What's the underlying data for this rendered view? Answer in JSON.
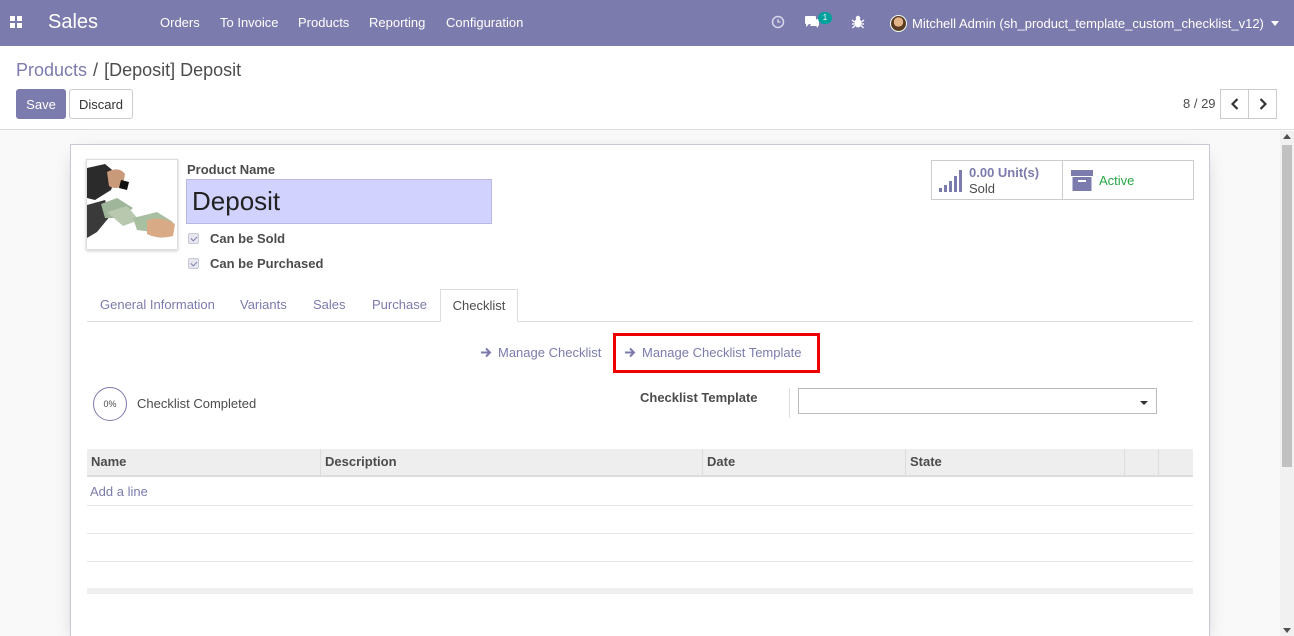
{
  "navbar": {
    "app_name": "Sales",
    "menu": [
      "Orders",
      "To Invoice",
      "Products",
      "Reporting",
      "Configuration"
    ],
    "messages_badge": "1",
    "user_name": "Mitchell Admin (sh_product_template_custom_checklist_v12)",
    "bg_color": "#7c7bad"
  },
  "control_panel": {
    "breadcrumb_parent": "Products",
    "breadcrumb_separator": "/",
    "breadcrumb_current": "[Deposit] Deposit",
    "save_label": "Save",
    "discard_label": "Discard",
    "pager": "8 / 29"
  },
  "product": {
    "name_label": "Product Name",
    "name_value": "Deposit",
    "can_be_sold_label": "Can be Sold",
    "can_be_sold": true,
    "can_be_purchased_label": "Can be Purchased",
    "can_be_purchased": true,
    "image_icon": "product-photo-money-exchange"
  },
  "stat_buttons": {
    "sold_value": "0.00 Unit(s)",
    "sold_label": "Sold",
    "active_label": "Active"
  },
  "tabs": [
    "General Information",
    "Variants",
    "Sales",
    "Purchase",
    "Checklist"
  ],
  "active_tab": "Checklist",
  "checklist": {
    "manage_checklist_label": "Manage Checklist",
    "manage_template_label": "Manage Checklist Template",
    "progress_text": "0%",
    "progress_label": "Checklist Completed",
    "template_label": "Checklist Template",
    "template_value": ""
  },
  "table": {
    "columns": [
      "Name",
      "Description",
      "Date",
      "State"
    ],
    "add_line_label": "Add a line"
  },
  "colors": {
    "accent": "#7c7bad",
    "active_green": "#28a745",
    "highlight_red": "#e00000",
    "name_input_bg": "#d2d2ff"
  }
}
